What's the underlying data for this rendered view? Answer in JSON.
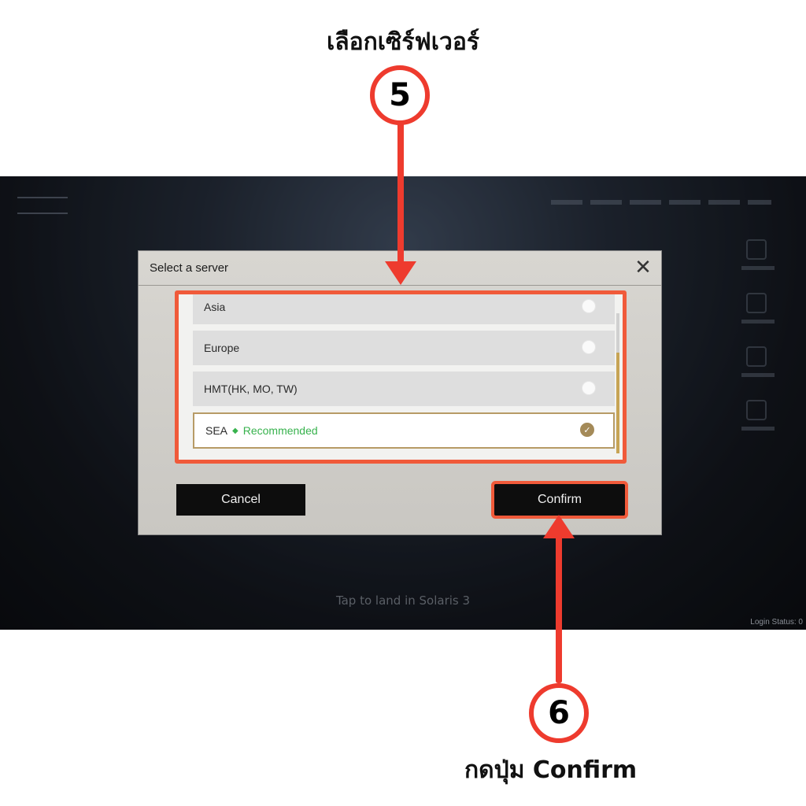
{
  "annotation": {
    "top_caption": "เลือกเซิร์ฟเวอร์",
    "bottom_caption": "กดปุ่ม Confirm",
    "step_a": "5",
    "step_b": "6",
    "accent_color": "#ee3b2e"
  },
  "game": {
    "tap_text": "Tap to land in Solaris 3",
    "login_status": "Login Status: 0"
  },
  "dialog": {
    "title": "Select a server",
    "close_icon": "close-x-icon",
    "servers": [
      {
        "name": "Asia",
        "selected": false
      },
      {
        "name": "Europe",
        "selected": false
      },
      {
        "name": "HMT(HK, MO, TW)",
        "selected": false
      },
      {
        "name": "SEA",
        "selected": true,
        "tag": "Recommended"
      }
    ],
    "cancel_label": "Cancel",
    "confirm_label": "Confirm"
  }
}
